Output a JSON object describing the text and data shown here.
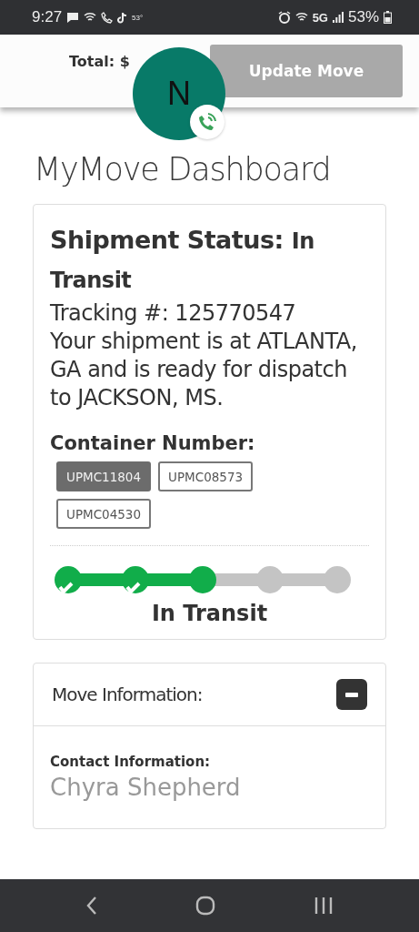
{
  "status_bar": {
    "time": "9:27",
    "temperature": "53°",
    "network": "5G",
    "battery": "53%"
  },
  "header": {
    "total_label": "Total: $",
    "button": {
      "label": "Update Move",
      "disabled": true
    },
    "chat_avatar": {
      "initial": "N"
    }
  },
  "page_title": "MyMove Dashboard",
  "shipment": {
    "status_label": "Shipment Status:",
    "status_value": "In Transit",
    "tracking": "Tracking #: 125770547",
    "message": "Your shipment is at ATLANTA, GA and is ready for dispatch to JACKSON, MS.",
    "container_label": "Container Number:",
    "containers": [
      {
        "label": "UPMC11804",
        "selected": true
      },
      {
        "label": "UPMC08573",
        "selected": false
      },
      {
        "label": "UPMC04530",
        "selected": false
      }
    ],
    "steps": [
      {
        "reached": true,
        "checked": true
      },
      {
        "reached": true,
        "checked": true
      },
      {
        "reached": true,
        "checked": false
      },
      {
        "reached": false,
        "checked": false
      },
      {
        "reached": false,
        "checked": false
      }
    ],
    "step_label": "In Transit"
  },
  "move_info": {
    "title": "Move Information:",
    "expanded": true,
    "contact_label": "Contact Information:",
    "contact_name": "Chyra Shepherd"
  }
}
